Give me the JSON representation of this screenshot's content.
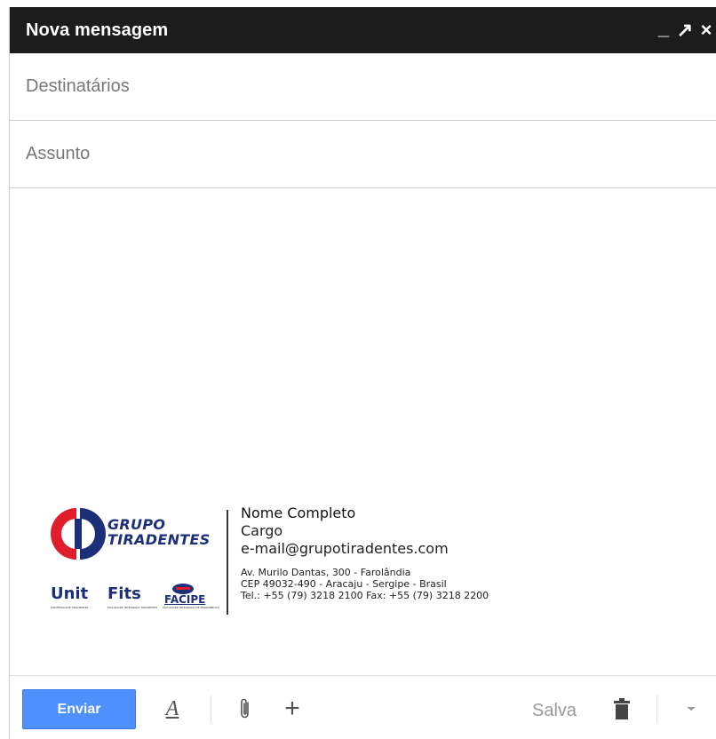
{
  "window": {
    "title": "Nova mensagem",
    "controls": {
      "minimize": "_",
      "popout": "↗",
      "close": "×"
    }
  },
  "fields": {
    "to_placeholder": "Destinatários",
    "subject_placeholder": "Assunto"
  },
  "signature": {
    "logo_line1": "GRUPO",
    "logo_line2": "TIRADENTES",
    "brands": {
      "unit": "Unit",
      "unit_sub": "UNIVERSIDADE TIRADENTES",
      "fits": "Fits",
      "fits_sub": "FACULDADE INTEGRADA TIRADENTES",
      "facipe": "FACIPE",
      "facipe_sub": "FACULDADE INTEGRADA DE PERNAMBUCO"
    },
    "name": "Nome Completo",
    "role": "Cargo",
    "email": "e-mail@grupotiradentes.com",
    "address_line1": "Av. Murilo Dantas, 300 - Farolândia",
    "address_line2": "CEP 49032-490 - Aracaju - Sergipe - Brasil",
    "phones": "Tel.: +55 (79) 3218 2100 Fax: +55 (79) 3218 2200"
  },
  "toolbar": {
    "send_label": "Enviar",
    "format_label": "A",
    "more_label": "+",
    "saved_status": "Salva"
  },
  "colors": {
    "titlebar": "#1c1c1c",
    "send_button": "#4d90fe",
    "logo_red": "#e01e2b",
    "logo_blue": "#1d2f78"
  }
}
